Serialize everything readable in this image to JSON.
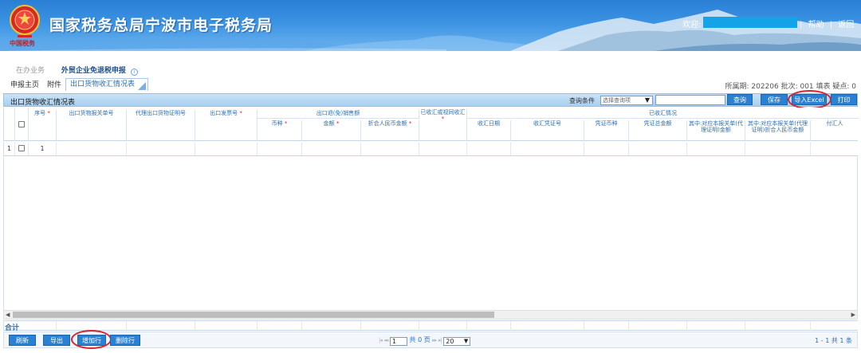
{
  "header": {
    "site_title": "国家税务总局宁波市电子税务局",
    "welcome": "欢迎:",
    "links": [
      "帮助",
      "返回"
    ]
  },
  "breadcrumb": {
    "pending": "在办业务",
    "current": "外贸企业免退税申报"
  },
  "subtabs": [
    "申报主页",
    "附件",
    "出口货物收汇情况表"
  ],
  "period_info": "所属期: 202206  批次: 001  填表  疑点: 0",
  "panel": {
    "title": "出口货物收汇情况表",
    "query_label": "查询条件",
    "query_select": "选择查询项",
    "query_input": "",
    "buttons": {
      "query": "查询",
      "save": "保存",
      "import": "导入Excel",
      "print": "打印"
    }
  },
  "columns": {
    "seq": "序号",
    "customs_no": "出口货物报关单号",
    "agent_cert": "代理出口货物证明号",
    "invoice_no": "出口发票号",
    "sales_group": "出口退(免)销售额",
    "currency": "币种",
    "amount": "金额",
    "rmb_amount": "折合人民币金额",
    "received_flag": "已收汇或视同收汇",
    "received_group": "已收汇情况",
    "recv_date": "收汇日期",
    "recv_voucher": "收汇凭证号",
    "voucher_currency": "凭证币种",
    "voucher_total": "凭证总金额",
    "portion_amount": "其中:对应本报关单(代理证明)金额",
    "portion_rmb": "其中:对应本报关单(代理证明)折合人民币金额",
    "payer": "付汇人"
  },
  "rows": [
    {
      "row_no": "1",
      "seq": "1"
    }
  ],
  "total_label": "合计",
  "footer": {
    "buttons": {
      "refresh": "刷新",
      "export": "导出",
      "add_row": "增加行",
      "delete_row": "删除行"
    },
    "page_input": "1",
    "page_total": "共 0 页",
    "page_size": "20",
    "range": "1 - 1  共 1 条"
  },
  "colors": {
    "banner_blue": "#3b93e3",
    "button_blue": "#2a80d2",
    "header_text": "#2a6fb5",
    "highlight_circle": "#d9232d",
    "required_mark": "#e02020"
  }
}
